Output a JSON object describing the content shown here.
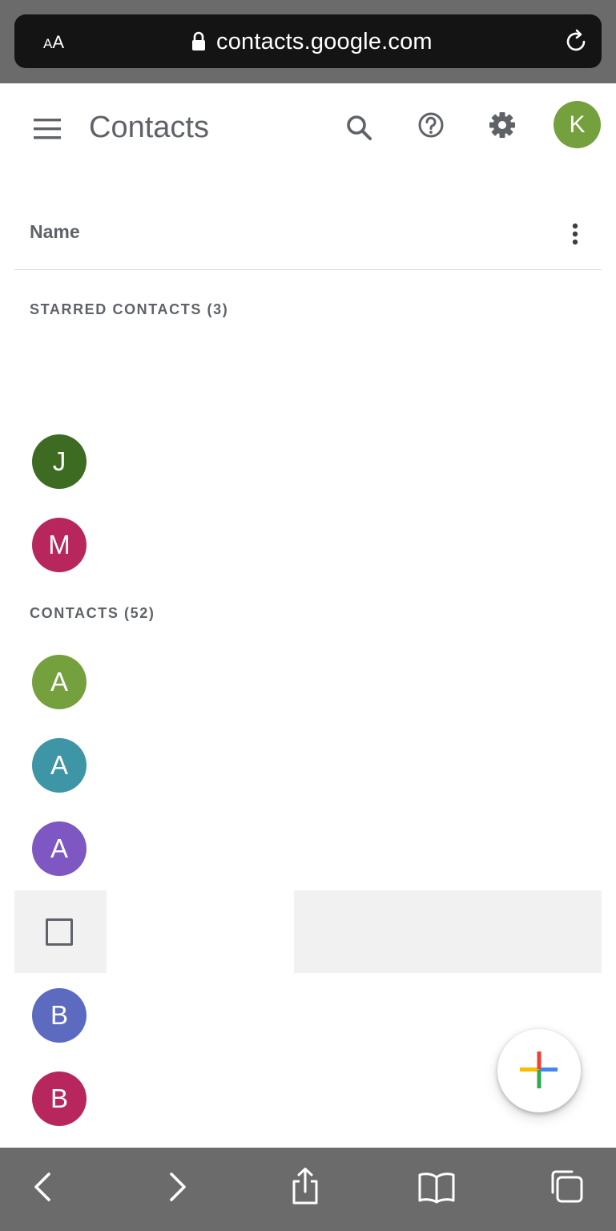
{
  "browser": {
    "text_size_label_small": "A",
    "text_size_label_large": "A",
    "url": "contacts.google.com"
  },
  "header": {
    "title": "Contacts",
    "account_initial": "K",
    "account_color": "#75a03e"
  },
  "list": {
    "column_label": "Name",
    "starred_label": "STARRED CONTACTS (3)",
    "contacts_label": "CONTACTS (52)",
    "starred": [
      {
        "initial": "J",
        "color": "#3d6b22"
      },
      {
        "initial": "M",
        "color": "#b7275e"
      }
    ],
    "contacts": [
      {
        "initial": "A",
        "color": "#75a03e"
      },
      {
        "initial": "A",
        "color": "#3d95a6"
      },
      {
        "initial": "A",
        "color": "#7e57c2"
      },
      {
        "initial": "B",
        "color": "#5c6bc0"
      },
      {
        "initial": "B",
        "color": "#b7275e"
      }
    ]
  },
  "icons": {
    "menu": "menu-icon",
    "search": "search-icon",
    "help": "help-icon",
    "settings": "gear-icon",
    "more": "more-vert-icon",
    "add": "plus-icon",
    "lock": "lock-icon",
    "reload": "reload-icon",
    "back": "chevron-left-icon",
    "forward": "chevron-right-icon",
    "share": "share-icon",
    "bookmarks": "book-icon",
    "tabs": "tabs-icon"
  }
}
